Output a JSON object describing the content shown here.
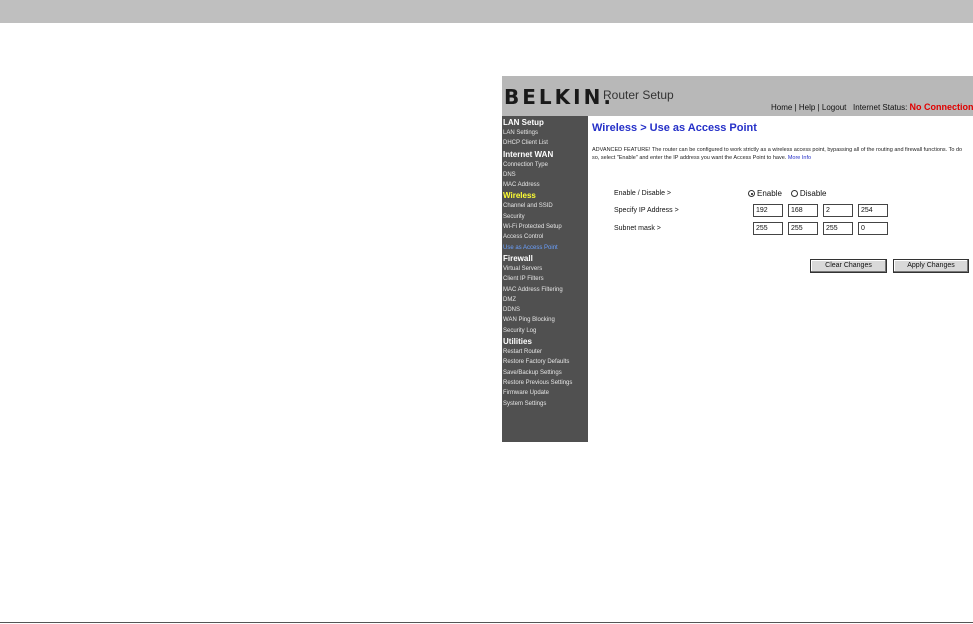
{
  "header": {
    "logo": "BELKIN",
    "logo_suffix": ".",
    "subtitle": "Router Setup",
    "links": [
      "Home",
      "Help",
      "Logout"
    ],
    "link_sep": "|",
    "internet_status_label": "Internet Status:",
    "internet_status_value": "No Connection"
  },
  "sidebar": {
    "items": [
      {
        "label": "LAN Setup",
        "kind": "head"
      },
      {
        "label": "LAN Settings",
        "kind": "item"
      },
      {
        "label": "DHCP Client List",
        "kind": "item"
      },
      {
        "label": "Internet WAN",
        "kind": "head"
      },
      {
        "label": "Connection Type",
        "kind": "item"
      },
      {
        "label": "DNS",
        "kind": "item"
      },
      {
        "label": "MAC Address",
        "kind": "item"
      },
      {
        "label": "Wireless",
        "kind": "head-active"
      },
      {
        "label": "Channel and SSID",
        "kind": "item"
      },
      {
        "label": "Security",
        "kind": "item"
      },
      {
        "label": "Wi-Fi Protected Setup",
        "kind": "item"
      },
      {
        "label": "Access Control",
        "kind": "item"
      },
      {
        "label": "Use as Access Point",
        "kind": "item-active"
      },
      {
        "label": "Firewall",
        "kind": "head"
      },
      {
        "label": "Virtual Servers",
        "kind": "item"
      },
      {
        "label": "Client IP Filters",
        "kind": "item"
      },
      {
        "label": "MAC Address Filtering",
        "kind": "item"
      },
      {
        "label": "DMZ",
        "kind": "item"
      },
      {
        "label": "DDNS",
        "kind": "item"
      },
      {
        "label": "WAN Ping Blocking",
        "kind": "item"
      },
      {
        "label": "Security Log",
        "kind": "item"
      },
      {
        "label": "Utilities",
        "kind": "head"
      },
      {
        "label": "Restart Router",
        "kind": "item"
      },
      {
        "label": "Restore Factory Defaults",
        "kind": "item"
      },
      {
        "label": "Save/Backup Settings",
        "kind": "item"
      },
      {
        "label": "Restore Previous Settings",
        "kind": "item"
      },
      {
        "label": "Firmware Update",
        "kind": "item"
      },
      {
        "label": "System Settings",
        "kind": "item"
      }
    ]
  },
  "main": {
    "title": "Wireless > Use as Access Point",
    "description": "ADVANCED FEATURE! The router can be configured to work strictly as a wireless access point, bypassing all of the routing and firewall functions. To do so, select \"Enable\" and enter the IP address you want the Access Point to have.",
    "more_info": "More Info",
    "enable_label": "Enable / Disable >",
    "enable_option": "Enable",
    "disable_option": "Disable",
    "selected": "Enable",
    "ip_label": "Specify IP Address >",
    "ip_octets": [
      "192",
      "168",
      "2",
      "254"
    ],
    "subnet_label": "Subnet mask >",
    "subnet_octets": [
      "255",
      "255",
      "255",
      "0"
    ],
    "clear_button": "Clear Changes",
    "apply_button": "Apply Changes"
  }
}
